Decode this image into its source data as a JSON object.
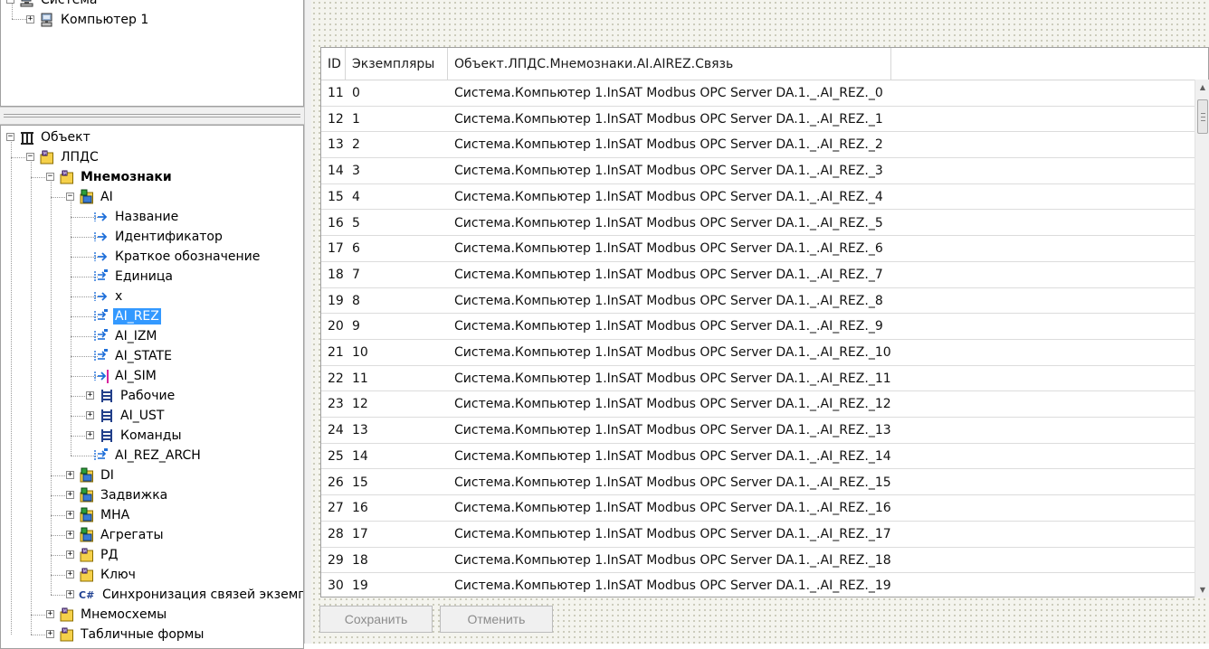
{
  "system_tree": {
    "items": [
      {
        "label": "Система",
        "expander": "−",
        "icon": "computer-group-icon"
      },
      {
        "label": "Компьютер 1",
        "expander": "+",
        "icon": "computer-icon"
      }
    ]
  },
  "object_tree": {
    "items": [
      {
        "label": "Объект",
        "expander": "−",
        "icon": "object-root-icon"
      },
      {
        "label": "ЛПДС",
        "expander": "−",
        "icon": "folder-icon"
      },
      {
        "label": "Мнемознаки",
        "expander": "−",
        "icon": "folder-icon"
      },
      {
        "label": "AI",
        "expander": "−",
        "icon": "class-icon"
      },
      {
        "label": "Название",
        "icon": "attribute-icon"
      },
      {
        "label": "Идентификатор",
        "icon": "attribute-icon"
      },
      {
        "label": "Краткое обозначение",
        "icon": "attribute-icon"
      },
      {
        "label": "Единица",
        "icon": "link-attribute-icon"
      },
      {
        "label": "x",
        "icon": "attribute-icon"
      },
      {
        "label": "AI_REZ",
        "icon": "link-attribute-icon"
      },
      {
        "label": "AI_IZM",
        "icon": "link-attribute-icon"
      },
      {
        "label": "AI_STATE",
        "icon": "link-attribute-icon"
      },
      {
        "label": "AI_SIM",
        "icon": "write-attribute-icon"
      },
      {
        "label": "Рабочие",
        "expander": "+",
        "icon": "group-icon"
      },
      {
        "label": "AI_UST",
        "expander": "+",
        "icon": "group-icon"
      },
      {
        "label": "Команды",
        "expander": "+",
        "icon": "group-icon"
      },
      {
        "label": "AI_REZ_ARCH",
        "icon": "link-attribute-icon"
      },
      {
        "label": "DI",
        "expander": "+",
        "icon": "class-icon"
      },
      {
        "label": "Задвижка",
        "expander": "+",
        "icon": "class-icon"
      },
      {
        "label": "МНА",
        "expander": "+",
        "icon": "class-icon"
      },
      {
        "label": "Агрегаты",
        "expander": "+",
        "icon": "class-icon"
      },
      {
        "label": "РД",
        "expander": "+",
        "icon": "folder-icon"
      },
      {
        "label": "Ключ",
        "expander": "+",
        "icon": "folder-icon"
      },
      {
        "label": "Синхронизация связей экземпл",
        "expander": "+",
        "icon": "csharp-script-icon",
        "icon_text": "C#"
      },
      {
        "label": "Мнемосхемы",
        "expander": "+",
        "icon": "folder-icon"
      },
      {
        "label": "Табличные формы",
        "expander": "+",
        "icon": "folder-icon"
      }
    ]
  },
  "grid": {
    "columns": [
      "ID",
      "Экземпляры",
      "Объект.ЛПДС.Мнемознаки.AI.AIREZ.Связь"
    ],
    "rows": [
      {
        "id": "11",
        "instance": "0",
        "link": "Система.Компьютер 1.InSAT Modbus OPC Server DA.1._.AI_REZ._0"
      },
      {
        "id": "12",
        "instance": "1",
        "link": "Система.Компьютер 1.InSAT Modbus OPC Server DA.1._.AI_REZ._1"
      },
      {
        "id": "13",
        "instance": "2",
        "link": "Система.Компьютер 1.InSAT Modbus OPC Server DA.1._.AI_REZ._2"
      },
      {
        "id": "14",
        "instance": "3",
        "link": "Система.Компьютер 1.InSAT Modbus OPC Server DA.1._.AI_REZ._3"
      },
      {
        "id": "15",
        "instance": "4",
        "link": "Система.Компьютер 1.InSAT Modbus OPC Server DA.1._.AI_REZ._4"
      },
      {
        "id": "16",
        "instance": "5",
        "link": "Система.Компьютер 1.InSAT Modbus OPC Server DA.1._.AI_REZ._5"
      },
      {
        "id": "17",
        "instance": "6",
        "link": "Система.Компьютер 1.InSAT Modbus OPC Server DA.1._.AI_REZ._6"
      },
      {
        "id": "18",
        "instance": "7",
        "link": "Система.Компьютер 1.InSAT Modbus OPC Server DA.1._.AI_REZ._7"
      },
      {
        "id": "19",
        "instance": "8",
        "link": "Система.Компьютер 1.InSAT Modbus OPC Server DA.1._.AI_REZ._8"
      },
      {
        "id": "20",
        "instance": "9",
        "link": "Система.Компьютер 1.InSAT Modbus OPC Server DA.1._.AI_REZ._9"
      },
      {
        "id": "21",
        "instance": "10",
        "link": "Система.Компьютер 1.InSAT Modbus OPC Server DA.1._.AI_REZ._10"
      },
      {
        "id": "22",
        "instance": "11",
        "link": "Система.Компьютер 1.InSAT Modbus OPC Server DA.1._.AI_REZ._11"
      },
      {
        "id": "23",
        "instance": "12",
        "link": "Система.Компьютер 1.InSAT Modbus OPC Server DA.1._.AI_REZ._12"
      },
      {
        "id": "24",
        "instance": "13",
        "link": "Система.Компьютер 1.InSAT Modbus OPC Server DA.1._.AI_REZ._13"
      },
      {
        "id": "25",
        "instance": "14",
        "link": "Система.Компьютер 1.InSAT Modbus OPC Server DA.1._.AI_REZ._14"
      },
      {
        "id": "26",
        "instance": "15",
        "link": "Система.Компьютер 1.InSAT Modbus OPC Server DA.1._.AI_REZ._15"
      },
      {
        "id": "27",
        "instance": "16",
        "link": "Система.Компьютер 1.InSAT Modbus OPC Server DA.1._.AI_REZ._16"
      },
      {
        "id": "28",
        "instance": "17",
        "link": "Система.Компьютер 1.InSAT Modbus OPC Server DA.1._.AI_REZ._17"
      },
      {
        "id": "29",
        "instance": "18",
        "link": "Система.Компьютер 1.InSAT Modbus OPC Server DA.1._.AI_REZ._18"
      },
      {
        "id": "30",
        "instance": "19",
        "link": "Система.Компьютер 1.InSAT Modbus OPC Server DA.1._.AI_REZ._19"
      }
    ]
  },
  "buttons": {
    "save": "Сохранить",
    "cancel": "Отменить"
  },
  "colors": {
    "selection": "#3399ff",
    "disabled_text": "#8c8c8c",
    "folder": "#f5d04a",
    "attribute_arrow": "#1e6fd9",
    "write_marker": "#d6249f"
  }
}
